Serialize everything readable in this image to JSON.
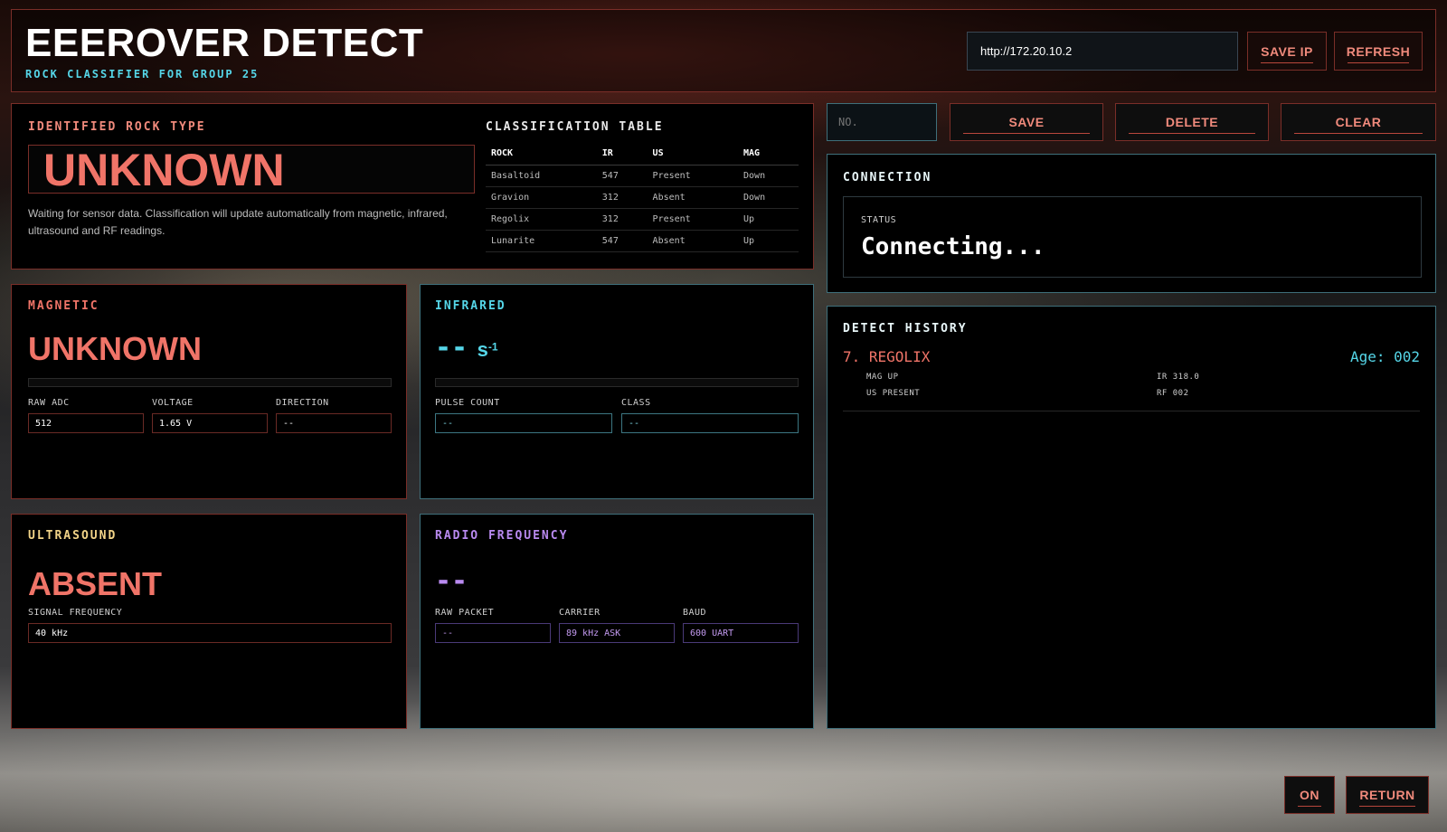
{
  "header": {
    "title": "EEEROVER DETECT",
    "subtitle": "ROCK CLASSIFIER FOR GROUP 25",
    "ip_value": "http://172.20.10.2",
    "save_ip_label": "SAVE IP",
    "refresh_label": "REFRESH"
  },
  "identified": {
    "label": "IDENTIFIED ROCK TYPE",
    "value": "UNKNOWN",
    "description": "Waiting for sensor data. Classification will update automatically from magnetic, infrared, ultrasound and RF readings."
  },
  "classification": {
    "label": "CLASSIFICATION TABLE",
    "headers": [
      "ROCK",
      "IR",
      "US",
      "MAG"
    ],
    "rows": [
      [
        "Basaltoid",
        "547",
        "Present",
        "Down"
      ],
      [
        "Gravion",
        "312",
        "Absent",
        "Down"
      ],
      [
        "Regolix",
        "312",
        "Present",
        "Up"
      ],
      [
        "Lunarite",
        "547",
        "Absent",
        "Up"
      ]
    ]
  },
  "toolbar": {
    "no_placeholder": "NO.",
    "save_label": "SAVE",
    "delete_label": "DELETE",
    "clear_label": "CLEAR"
  },
  "connection": {
    "label": "CONNECTION",
    "status_label": "STATUS",
    "status_value": "Connecting..."
  },
  "magnetic": {
    "label": "MAGNETIC",
    "value": "UNKNOWN",
    "raw_adc_label": "RAW ADC",
    "voltage_label": "VOLTAGE",
    "direction_label": "DIRECTION",
    "raw_adc": "512",
    "voltage": "1.65 V",
    "direction": "--",
    "level": 0
  },
  "infrared": {
    "label": "INFRARED",
    "value": "--",
    "unit": "s",
    "unit_exp": "-1",
    "pulse_count_label": "PULSE COUNT",
    "class_label": "CLASS",
    "pulse_count": "--",
    "class": "--",
    "level": 0
  },
  "ultrasound": {
    "label": "ULTRASOUND",
    "value": "ABSENT",
    "signal_freq_label": "SIGNAL FREQUENCY",
    "signal_freq": "40 kHz"
  },
  "rf": {
    "label": "RADIO FREQUENCY",
    "value": "--",
    "raw_packet_label": "RAW PACKET",
    "carrier_label": "CARRIER",
    "baud_label": "BAUD",
    "raw_packet": "--",
    "carrier": "89 kHz ASK",
    "baud": "600 UART"
  },
  "history": {
    "label": "DETECT HISTORY",
    "entries": [
      {
        "title": "7. REGOLIX",
        "age": "Age: 002",
        "mag": "MAG UP",
        "us": "US PRESENT",
        "ir": "IR 318.0",
        "rf": "RF 002"
      }
    ]
  },
  "footer": {
    "on_label": "ON",
    "return_label": "RETURN"
  },
  "colors": {
    "accent_red": "#f07468",
    "accent_cyan": "#55d6e8",
    "accent_yellow": "#f2d488",
    "accent_purple": "#b98af0"
  }
}
